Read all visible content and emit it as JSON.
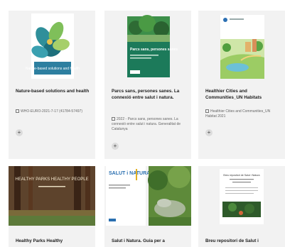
{
  "cards": [
    {
      "title": "Nature-based solutions and health",
      "meta": "WHO-EURO-2021-7-17 (41784-57497)",
      "cover_text": "Nature-based solutions and health",
      "add_label": "+"
    },
    {
      "title": "Parcs sans, persones sanes. La connexió entre salut i natura.",
      "meta": "2022 - Parcs sans, persones sanes. La connexió entre salut i natura. Generalitat de Catalunya",
      "cover_text": "Parcs sans, persones sanes",
      "add_label": "+"
    },
    {
      "title": "Healthier Cities and Communities_UN Habitats",
      "meta": "Healthier Cities and Communities_UN Habitat 2021",
      "cover_text": "",
      "add_label": "+"
    },
    {
      "title": "Healthy Parks Healthy",
      "cover_text": "HEALTHY PARKS HEALTHY PEOPLE"
    },
    {
      "title": "Salut i Natura. Guia per a",
      "cover_text": "SALUT i NATURA"
    },
    {
      "title": "Breu repositori de Salut i",
      "cover_text": "Breu repositori de Salut i Natura"
    }
  ]
}
